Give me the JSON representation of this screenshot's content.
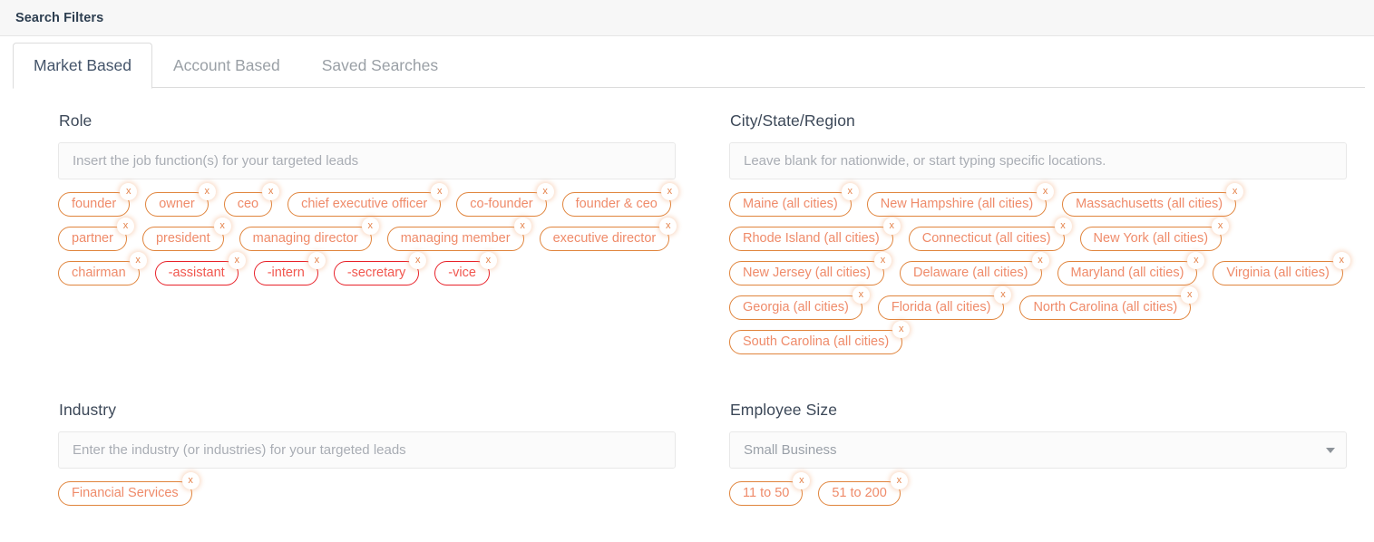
{
  "header": {
    "title": "Search Filters"
  },
  "tabs": [
    {
      "label": "Market Based",
      "active": true
    },
    {
      "label": "Account Based",
      "active": false
    },
    {
      "label": "Saved Searches",
      "active": false
    }
  ],
  "colors": {
    "tag_border": "#e0843c",
    "tag_text": "#ef8b6a",
    "tag_neg_border": "#e8222a",
    "tag_neg_text": "#f1574f",
    "heading": "#3c4858",
    "header_bg": "#f7f7f7"
  },
  "sections": {
    "role": {
      "label": "Role",
      "input": {
        "value": "",
        "placeholder": "Insert the job function(s) for your targeted leads"
      },
      "tags": [
        {
          "label": "founder",
          "negative": false
        },
        {
          "label": "owner",
          "negative": false
        },
        {
          "label": "ceo",
          "negative": false
        },
        {
          "label": "chief executive officer",
          "negative": false
        },
        {
          "label": "co-founder",
          "negative": false
        },
        {
          "label": "founder & ceo",
          "negative": false
        },
        {
          "label": "partner",
          "negative": false
        },
        {
          "label": "president",
          "negative": false
        },
        {
          "label": "managing director",
          "negative": false
        },
        {
          "label": "managing member",
          "negative": false
        },
        {
          "label": "executive director",
          "negative": false
        },
        {
          "label": "chairman",
          "negative": false
        },
        {
          "label": "-assistant",
          "negative": true
        },
        {
          "label": "-intern",
          "negative": true
        },
        {
          "label": "-secretary",
          "negative": true
        },
        {
          "label": "-vice",
          "negative": true
        }
      ]
    },
    "location": {
      "label": "City/State/Region",
      "input": {
        "value": "",
        "placeholder": "Leave blank for nationwide, or start typing specific locations."
      },
      "tags": [
        {
          "label": "Maine (all cities)",
          "negative": false
        },
        {
          "label": "New Hampshire (all cities)",
          "negative": false
        },
        {
          "label": "Massachusetts (all cities)",
          "negative": false
        },
        {
          "label": "Rhode Island (all cities)",
          "negative": false
        },
        {
          "label": "Connecticut (all cities)",
          "negative": false
        },
        {
          "label": "New York (all cities)",
          "negative": false
        },
        {
          "label": "New Jersey (all cities)",
          "negative": false
        },
        {
          "label": "Delaware (all cities)",
          "negative": false
        },
        {
          "label": "Maryland (all cities)",
          "negative": false
        },
        {
          "label": "Virginia (all cities)",
          "negative": false
        },
        {
          "label": "Georgia (all cities)",
          "negative": false
        },
        {
          "label": "Florida (all cities)",
          "negative": false
        },
        {
          "label": "North Carolina (all cities)",
          "negative": false
        },
        {
          "label": "South Carolina (all cities)",
          "negative": false
        }
      ]
    },
    "industry": {
      "label": "Industry",
      "input": {
        "value": "",
        "placeholder": "Enter the industry (or industries) for your targeted leads"
      },
      "tags": [
        {
          "label": "Financial Services",
          "negative": false
        }
      ]
    },
    "employee_size": {
      "label": "Employee Size",
      "select": {
        "value": "Small Business",
        "caret_icon": "chevron-down-icon"
      },
      "tags": [
        {
          "label": "11 to 50",
          "negative": false
        },
        {
          "label": "51 to 200",
          "negative": false
        }
      ]
    }
  },
  "tag_remove_glyph": "x"
}
